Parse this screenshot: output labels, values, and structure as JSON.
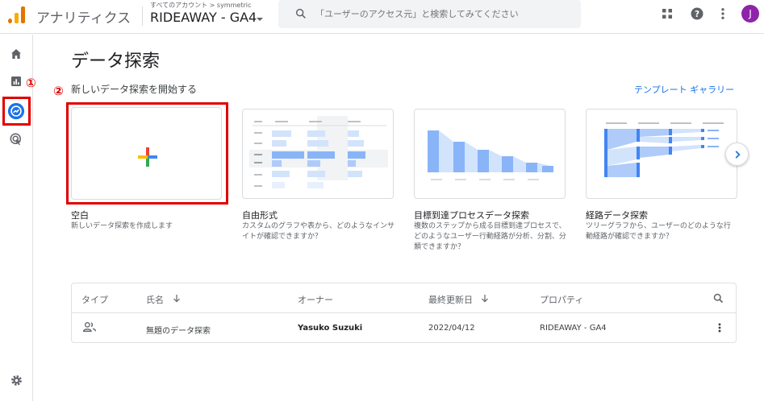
{
  "app": {
    "title": "アナリティクス"
  },
  "account": {
    "breadcrumb": "すべてのアカウント > symmetric",
    "name": "RIDEAWAY - GA4"
  },
  "search": {
    "placeholder": "「ユーザーのアクセス元」と検索してみてください"
  },
  "user": {
    "avatar_letter": "J"
  },
  "annotations": {
    "one": "①",
    "two": "②"
  },
  "main": {
    "title": "データ探索",
    "section_title": "新しいデータ探索を開始する",
    "template_gallery": "テンプレート ギャラリー"
  },
  "cards": [
    {
      "label": "空白",
      "desc": "新しいデータ探索を作成します"
    },
    {
      "label": "自由形式",
      "desc": "カスタムのグラフや表から、どのようなインサイトが確認できますか？"
    },
    {
      "label": "目標到達プロセスデータ探索",
      "desc": "複数のステップから成る目標到達プロセスで、どのようなユーザー行動経路が分析、分割、分類できますか？"
    },
    {
      "label": "経路データ探索",
      "desc": "ツリーグラフから、ユーザーのどのような行動経路が確認できますか？"
    }
  ],
  "table": {
    "headers": {
      "type": "タイプ",
      "name": "氏名",
      "owner": "オーナー",
      "updated": "最終更新日",
      "property": "プロパティ"
    },
    "rows": [
      {
        "name": "無題のデータ探索",
        "owner": "Yasuko Suzuki",
        "updated": "2022/04/12",
        "property": "RIDEAWAY - GA4"
      }
    ]
  },
  "colors": {
    "accent": "#1a73e8",
    "annotation_red": "#e00000",
    "avatar": "#8e24aa"
  }
}
